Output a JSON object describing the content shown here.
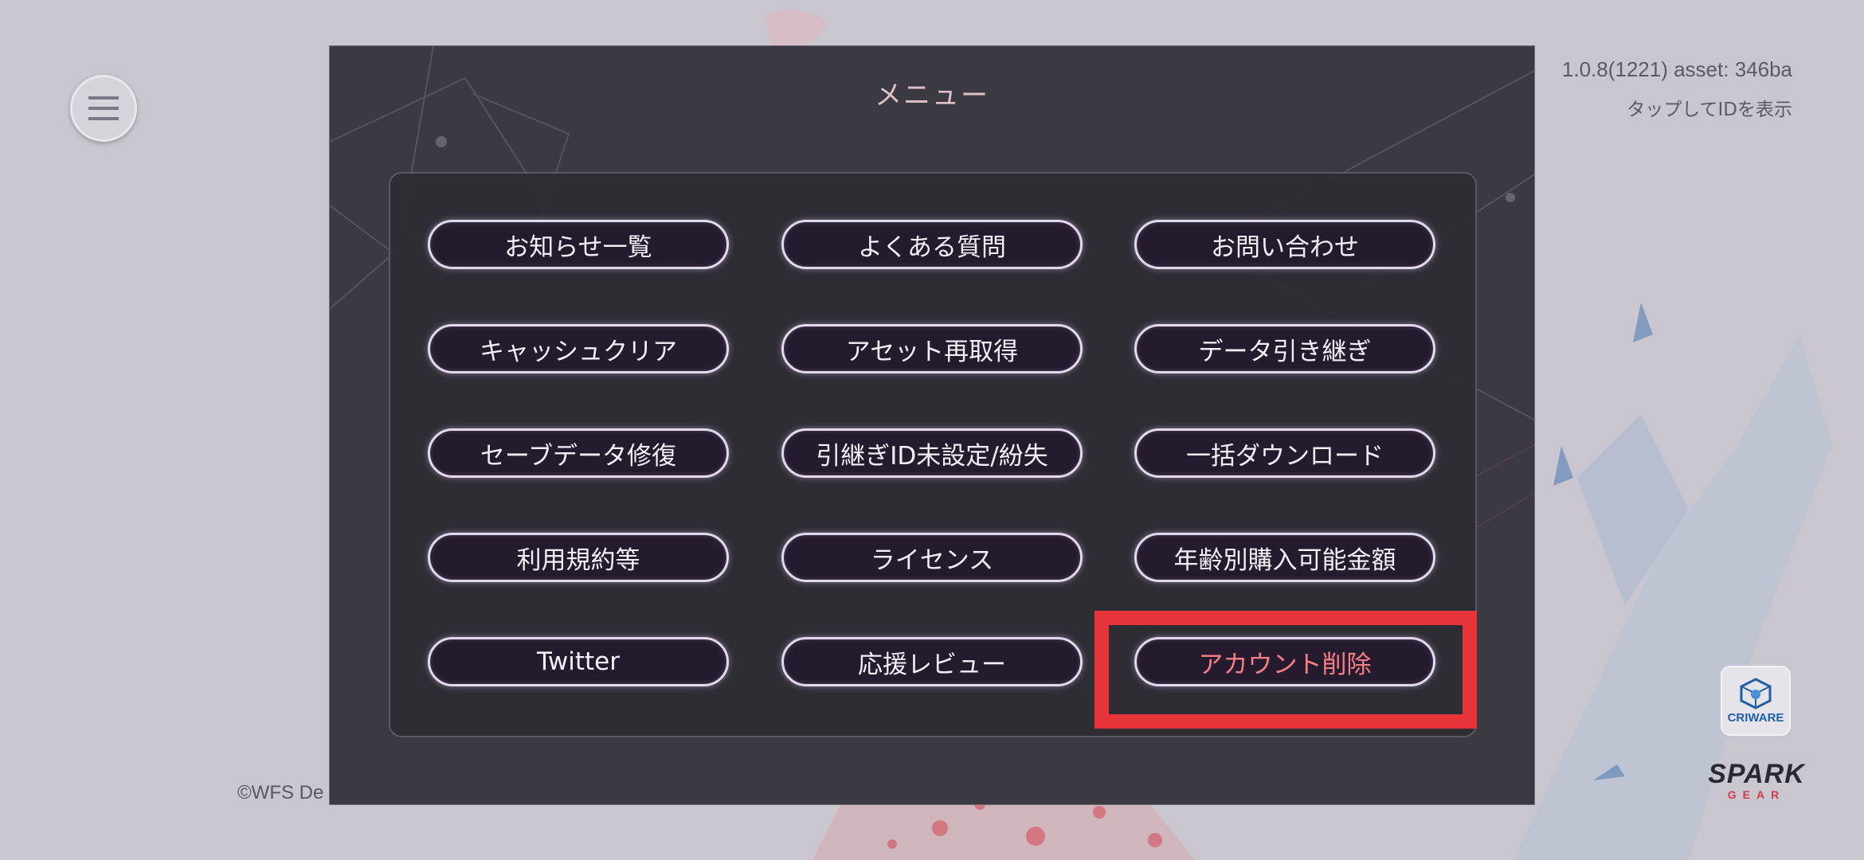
{
  "menu_button": {
    "icon": "hamburger-menu-icon"
  },
  "version_info": {
    "version": "1.0.8(1221) asset: 346ba",
    "tap_to_show_id": "タップしてIDを表示"
  },
  "copyright": "©WFS De",
  "modal": {
    "title": "メニュー",
    "buttons": [
      {
        "label": "お知らせ一覧"
      },
      {
        "label": "よくある質問"
      },
      {
        "label": "お問い合わせ"
      },
      {
        "label": "キャッシュクリア"
      },
      {
        "label": "アセット再取得"
      },
      {
        "label": "データ引き継ぎ"
      },
      {
        "label": "セーブデータ修復"
      },
      {
        "label": "引継ぎID未設定/紛失"
      },
      {
        "label": "一括ダウンロード"
      },
      {
        "label": "利用規約等"
      },
      {
        "label": "ライセンス"
      },
      {
        "label": "年齢別購入可能金額"
      },
      {
        "label": "Twitter"
      },
      {
        "label": "応援レビュー"
      },
      {
        "label": "アカウント削除"
      }
    ]
  },
  "logos": {
    "criware": "CRIWARE",
    "spark": "SPARK",
    "gear": "GEAR"
  },
  "colors": {
    "highlight": "#e8333a",
    "danger_text": "#ff7d85",
    "title_text": "#e0c2c6"
  }
}
